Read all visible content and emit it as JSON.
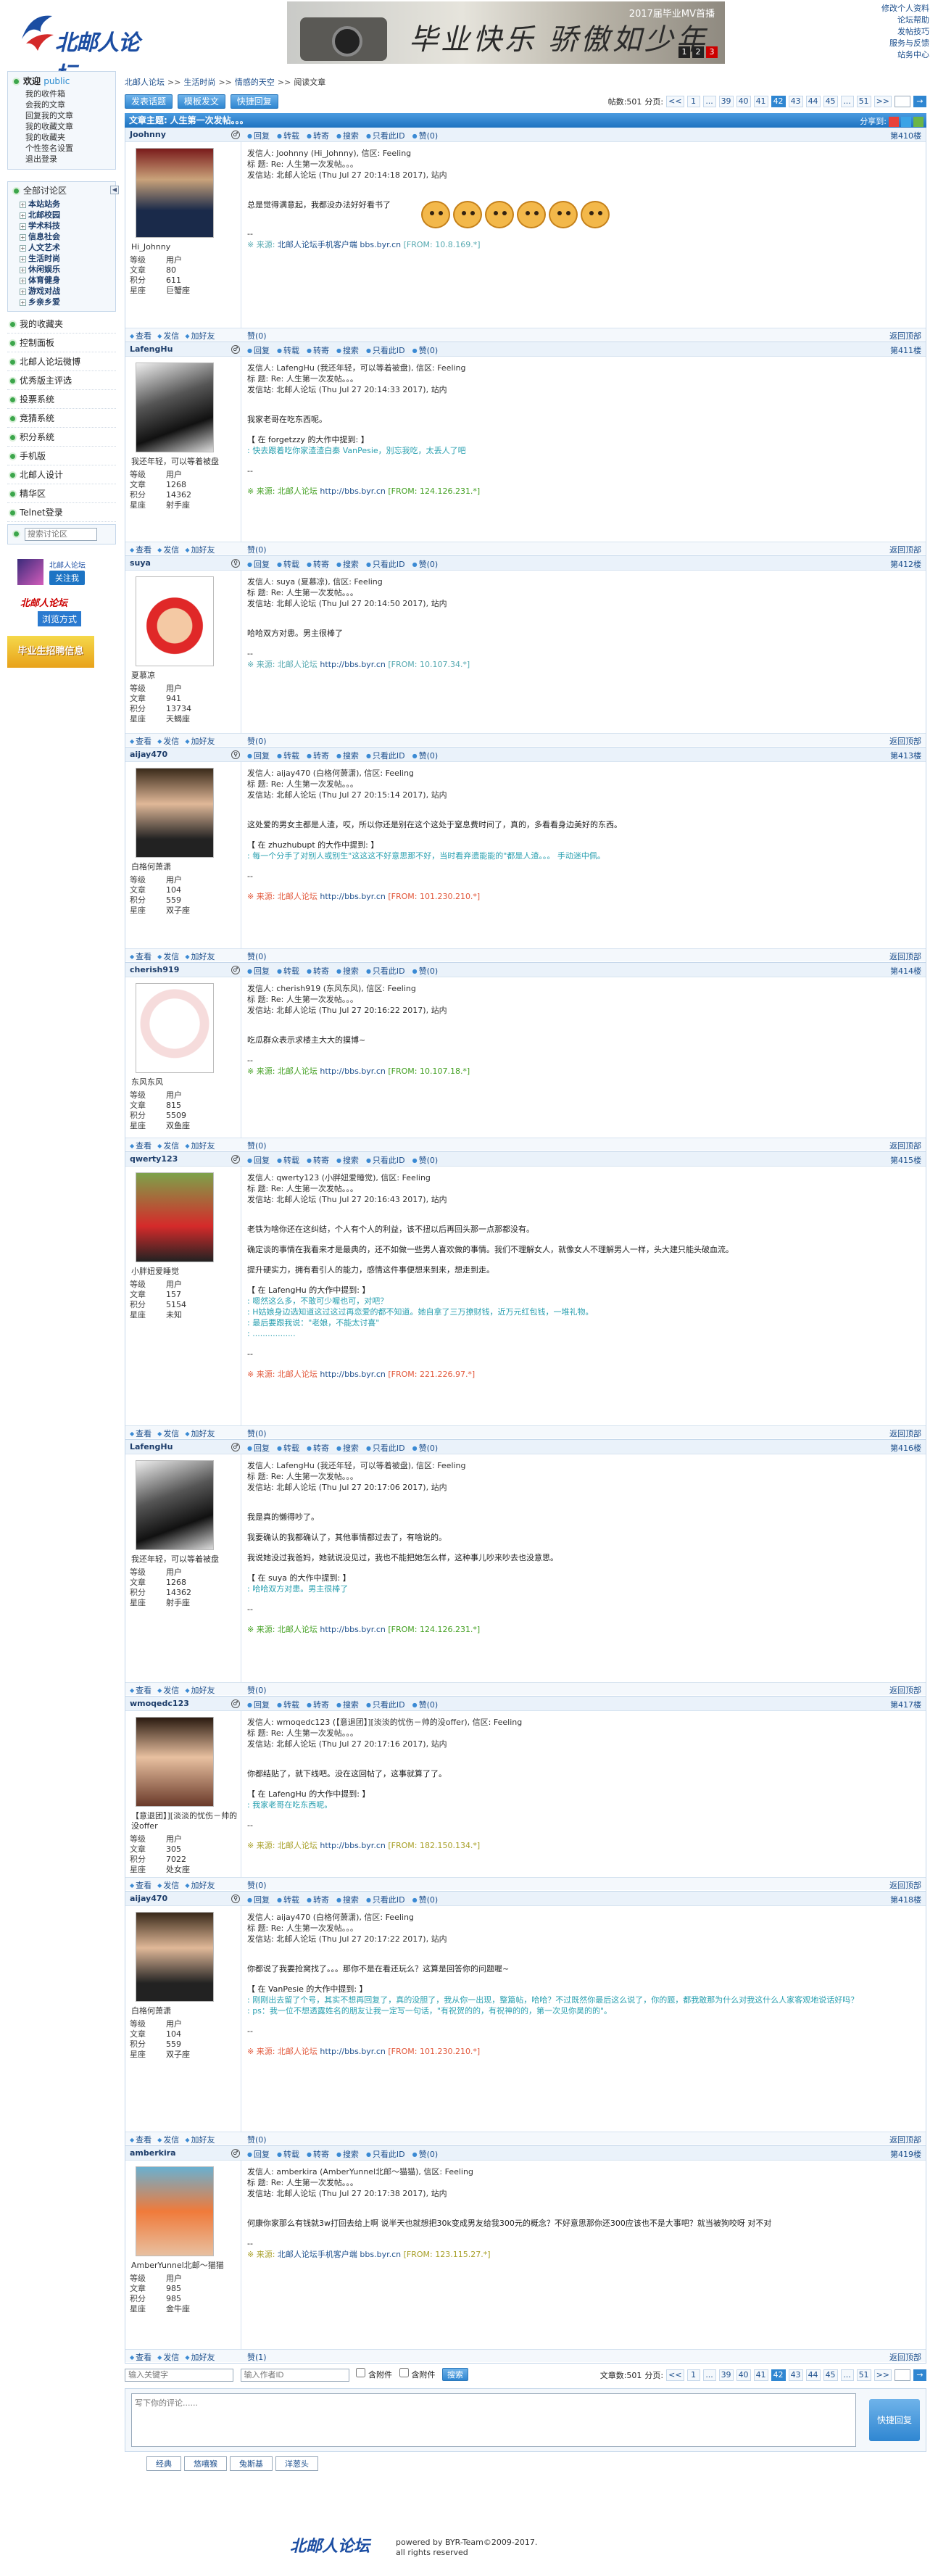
{
  "site": {
    "logo_text": "北邮人论坛",
    "banner_tag": "2017届毕业MV首播",
    "banner_text": "毕业快乐 骄傲如少年",
    "banner_pages": [
      "1",
      "2",
      "3"
    ]
  },
  "toplinks": [
    "修改个人资料",
    "论坛帮助",
    "发帖技巧",
    "服务与反馈",
    "站务中心"
  ],
  "user": {
    "welcome": "欢迎",
    "name": "public",
    "links": [
      "我的收件箱",
      "会我的文章",
      "回复我的文章",
      "我的收藏文章",
      "我的收藏夹",
      "个性签名设置",
      "退出登录"
    ]
  },
  "sidebar": {
    "all_boards": "全部讨论区",
    "boards": [
      "本站站务",
      "北邮校园",
      "学术科技",
      "信息社会",
      "人文艺术",
      "生活时尚",
      "休闲娱乐",
      "体育健身",
      "游戏对战",
      "乡亲乡爱"
    ],
    "nav": [
      "我的收藏夹",
      "控制面板",
      "北邮人论坛微博",
      "优秀版主评选",
      "投票系统",
      "竞猜系统",
      "积分系统",
      "手机版",
      "北邮人设计",
      "精华区",
      "Telnet登录"
    ],
    "search_placeholder": "搜索讨论区",
    "promo1_title": "北邮人论坛",
    "promo1_btn": "关注我",
    "promo2_title": "北邮人论坛",
    "promo2_btn": "浏览方式",
    "promo3": "毕业生招聘信息"
  },
  "breadcrumb": [
    "北邮人论坛",
    "生活时尚",
    "情感的天空",
    "阅读文章"
  ],
  "toolbar": {
    "btn_new": "发表话题",
    "btn_mode": "模板发文",
    "btn_quick": "快捷回复",
    "count_label": "帖数:501",
    "page_label": "分页:"
  },
  "pager": {
    "items": [
      "<<",
      "1",
      "...",
      "39",
      "40",
      "41",
      "42",
      "43",
      "44",
      "45",
      "...",
      "51",
      ">>"
    ],
    "current": "42"
  },
  "topic": {
    "label": "文章主题:",
    "title": "人生第一次发帖。。。",
    "share": "分享到:"
  },
  "post_actions": [
    "回复",
    "转载",
    "转寄",
    "搜索",
    "只看此ID",
    "赞(0)"
  ],
  "foot_actions": [
    "查看",
    "发信",
    "加好友"
  ],
  "back_top": "返回顶部",
  "stat_labels": [
    "等级",
    "文章",
    "积分",
    "星座"
  ],
  "posts": [
    {
      "author": "Joohnny",
      "floor": "第410楼",
      "nick": "Hi_Johnny",
      "stats": [
        "用户",
        "80",
        "611",
        "巨蟹座"
      ],
      "hdr": [
        "发信人: Joohnny (Hi_Johnny), 信区: Feeling",
        "标  题: Re: 人生第一次发帖。。。",
        "发信站: 北邮人论坛 (Thu Jul 27 20:14:18 2017), 站内"
      ],
      "body": [
        "总是觉得满意起，我都没办法好好看书了"
      ],
      "quote_head": "",
      "quote": [],
      "src_prefix": "※ 来源: ",
      "src_site": "北邮人论坛手机客户端",
      "src_url": "bbs.byr.cn",
      "src_from": "[FROM: 10.8.169.*]",
      "like": "赞(0)"
    },
    {
      "author": "LafengHu",
      "floor": "第411楼",
      "nick": "我还年轻，可以等着被盘",
      "stats": [
        "用户",
        "1268",
        "14362",
        "射手座"
      ],
      "hdr": [
        "发信人: LafengHu (我还年轻，可以等着被盘), 信区: Feeling",
        "标  题: Re: 人生第一次发帖。。。",
        "发信站: 北邮人论坛 (Thu Jul 27 20:14:33 2017), 站内"
      ],
      "body": [
        "我家老哥在吃东西呢。"
      ],
      "quote_head": "【 在 forgetzzy 的大作中提到: 】",
      "quote": [
        ": 快去跟着吃你家渣渣白秦 VanPesie，別忘我吃，太丢人了吧"
      ],
      "src_prefix": "※ 来源: 北邮人论坛 ",
      "src_site": "",
      "src_url": "http://bbs.byr.cn",
      "src_from": "[FROM: 124.126.231.*]",
      "like": "赞(0)"
    },
    {
      "author": "suya",
      "floor": "第412楼",
      "nick": "夏慕凉",
      "stats": [
        "用户",
        "941",
        "13734",
        "天蝎座"
      ],
      "hdr": [
        "发信人: suya (夏慕凉), 信区: Feeling",
        "标  题: Re: 人生第一次发帖。。。",
        "发信站: 北邮人论坛 (Thu Jul 27 20:14:50 2017), 站内"
      ],
      "body": [
        "哈哈双方对患。男主很棒了"
      ],
      "quote_head": "",
      "quote": [],
      "src_prefix": "※ 来源: 北邮人论坛 ",
      "src_site": "",
      "src_url": "http://bbs.byr.cn",
      "src_from": "[FROM: 10.107.34.*]",
      "like": "赞(0)"
    },
    {
      "author": "aijay470",
      "floor": "第413楼",
      "nick": "白格何萧潇",
      "stats": [
        "用户",
        "104",
        "559",
        "双子座"
      ],
      "hdr": [
        "发信人: aijay470 (白格何萧潇), 信区: Feeling",
        "标  题: Re: 人生第一次发帖。。。",
        "发信站: 北邮人论坛 (Thu Jul 27 20:15:14 2017), 站内"
      ],
      "body": [
        "这处爱的男女主都是人渣，哎，所以你还是别在这个这处于窒息费时间了，真的，多看看身边美好的东西。"
      ],
      "quote_head": "【 在 zhuzhubupt 的大作中提到: 】",
      "quote": [
        ": 每一个分手了对别人或别生\"这这这不好意思那不好，当时看弃遗能能的\"都是人渣。。。 手动迷中佩。"
      ],
      "src_prefix": "※ 来源: 北邮人论坛 ",
      "src_site": "",
      "src_url": "http://bbs.byr.cn",
      "src_from": "[FROM: 101.230.210.*]",
      "like": "赞(0)"
    },
    {
      "author": "cherish919",
      "floor": "第414楼",
      "nick": "东风东风",
      "stats": [
        "用户",
        "815",
        "5509",
        "双鱼座"
      ],
      "hdr": [
        "发信人: cherish919 (东风东风), 信区: Feeling",
        "标  题: Re: 人生第一次发帖。。。",
        "发信站: 北邮人论坛 (Thu Jul 27 20:16:22 2017), 站内"
      ],
      "body": [
        "吃瓜群众表示求楼主大大的摸博~"
      ],
      "quote_head": "",
      "quote": [],
      "src_prefix": "※ 来源: 北邮人论坛 ",
      "src_site": "",
      "src_url": "http://bbs.byr.cn",
      "src_from": "[FROM: 10.107.18.*]",
      "like": "赞(0)"
    },
    {
      "author": "qwerty123",
      "floor": "第415楼",
      "nick": "小胖妞爱睡觉",
      "stats": [
        "用户",
        "157",
        "5154",
        "未知"
      ],
      "hdr": [
        "发信人: qwerty123 (小胖妞爱睡觉), 信区: Feeling",
        "标  题: Re: 人生第一次发帖。。。",
        "发信站: 北邮人论坛 (Thu Jul 27 20:16:43 2017), 站内"
      ],
      "body": [
        "老铁为啥你还在这纠结，个人有个人的利益，该不扭以后再回头那一点那都没有。",
        "确定谈的事情在我看来才是最典的，还不如做一些男人喜欢做的事情。我们不理解女人，就像女人不理解男人一样，头大建只能头破血流。",
        "提升硬实力，拥有看引人的能力，感情这件事便想来到来，想走到走。"
      ],
      "quote_head": "【 在 LafengHu 的大作中提到: 】",
      "quote": [
        ": 嗯然这么多，不敢可少喔也可，对吧？",
        ": H姑娘身边选知道这过这过再恋爱的都不知道。她自拿了三万撩财钱，近万元红包钱，一堆礼物。",
        ": 最后要跟我说：\"老娘，不能太讨喜\"",
        ": ................."
      ],
      "src_prefix": "※ 来源: 北邮人论坛 ",
      "src_site": "",
      "src_url": "http://bbs.byr.cn",
      "src_from": "[FROM: 221.226.97.*]",
      "like": "赞(0)"
    },
    {
      "author": "LafengHu",
      "floor": "第416楼",
      "nick": "我还年轻，可以等着被盘",
      "stats": [
        "用户",
        "1268",
        "14362",
        "射手座"
      ],
      "hdr": [
        "发信人: LafengHu (我还年轻，可以等着被盘), 信区: Feeling",
        "标  题: Re: 人生第一次发帖。。。",
        "发信站: 北邮人论坛 (Thu Jul 27 20:17:06 2017), 站内"
      ],
      "body": [
        "我是真的懒得吵了。",
        "我要确认的我都确认了，其他事情都过去了，有啥说的。",
        "我说她没过我爸妈，她就说没见过，我也不能把她怎么样，这种事儿吵来吵去也没意思。"
      ],
      "quote_head": "【 在 suya 的大作中提到: 】",
      "quote": [
        ": 哈哈双方对患。男主很棒了"
      ],
      "src_prefix": "※ 来源: 北邮人论坛 ",
      "src_site": "",
      "src_url": "http://bbs.byr.cn",
      "src_from": "[FROM: 124.126.231.*]",
      "like": "赞(0)"
    },
    {
      "author": "wmoqedc123",
      "floor": "第417楼",
      "nick": "【意退团】][淡淡的忧伤－帅的没offer",
      "stats": [
        "用户",
        "305",
        "7022",
        "处女座"
      ],
      "hdr": [
        "发信人: wmoqedc123 (【意退团】][淡淡的忧伤－帅的没offer), 信区: Feeling",
        "标  题: Re: 人生第一次发帖。。。",
        "发信站: 北邮人论坛 (Thu Jul 27 20:17:16 2017), 站内"
      ],
      "body": [
        "你都结贴了，就下线吧。没在这回帖了，这事就算了了。"
      ],
      "quote_head": "【 在 LafengHu 的大作中提到: 】",
      "quote": [
        ": 我家老哥在吃东西呢。"
      ],
      "src_prefix": "※ 来源: 北邮人论坛 ",
      "src_site": "",
      "src_url": "http://bbs.byr.cn",
      "src_from": "[FROM: 182.150.134.*]",
      "like": "赞(0)"
    },
    {
      "author": "aijay470",
      "floor": "第418楼",
      "nick": "白格何萧潇",
      "stats": [
        "用户",
        "104",
        "559",
        "双子座"
      ],
      "hdr": [
        "发信人: aijay470 (白格何萧潇), 信区: Feeling",
        "标  题: Re: 人生第一次发帖。。。",
        "发信站: 北邮人论坛 (Thu Jul 27 20:17:22 2017), 站内"
      ],
      "body": [
        "你都说了我要抢窝找了。。。那你不是在看还玩么？这算是回答你的问题喔~"
      ],
      "quote_head": "【 在 VanPesie 的大作中提到: 】",
      "quote": [
        ": 刚刚出去留了个号，其实不想再回复了，真的没胆了，我从你一出现，整篇帖，哈哈？不过既然你最后这么说了，你的题，都我敢那为什么对我这什么人家客观地说话好吗？",
        ": ps：我一位不想透露姓名的朋友让我一定写一句话，\"有祝贺的的，有祝神的的，第一次见你昊的的\"。"
      ],
      "src_prefix": "※ 来源: 北邮人论坛 ",
      "src_site": "",
      "src_url": "http://bbs.byr.cn",
      "src_from": "[FROM: 101.230.210.*]",
      "like": "赞(0)"
    },
    {
      "author": "amberkira",
      "floor": "第419楼",
      "nick": "AmberYunnel北邮～猫猫",
      "stats": [
        "用户",
        "985",
        "985",
        "金牛座"
      ],
      "hdr": [
        "发信人: amberkira (AmberYunnel北邮～猫猫), 信区: Feeling",
        "标  题: Re: 人生第一次发帖。。。",
        "发信站: 北邮人论坛 (Thu Jul 27 20:17:38 2017), 站内"
      ],
      "body": [
        "何康你家那么有钱就3w打回去给上啊 说半天也就想把30k变成男友给我300元的概念？不好意思那你还300应该也不是大事吧？就当被狗咬呀 对不对"
      ],
      "quote_head": "",
      "quote": [],
      "src_prefix": "※ 来源: ",
      "src_site": "北邮人论坛手机客户端",
      "src_url": "bbs.byr.cn",
      "src_from": "[FROM: 123.115.27.*]",
      "like": "赞(1)"
    }
  ],
  "bottom": {
    "author_ph": "输入关键字",
    "id_ph": "输入作者ID",
    "with_att": "含附件",
    "no_att": "含附件",
    "search_btn": "搜索",
    "count": "文章数:501",
    "page_label": "分页:"
  },
  "reply": {
    "placeholder": "写下你的评论......",
    "submit": "快捷回复",
    "tabs": [
      "经典",
      "悠嘻猴",
      "兔斯基",
      "洋葱头"
    ]
  },
  "footer": {
    "logo": "北邮人论坛",
    "powered": "powered by BYR-Team©2009-2017.",
    "rights": "all rights reserved"
  }
}
